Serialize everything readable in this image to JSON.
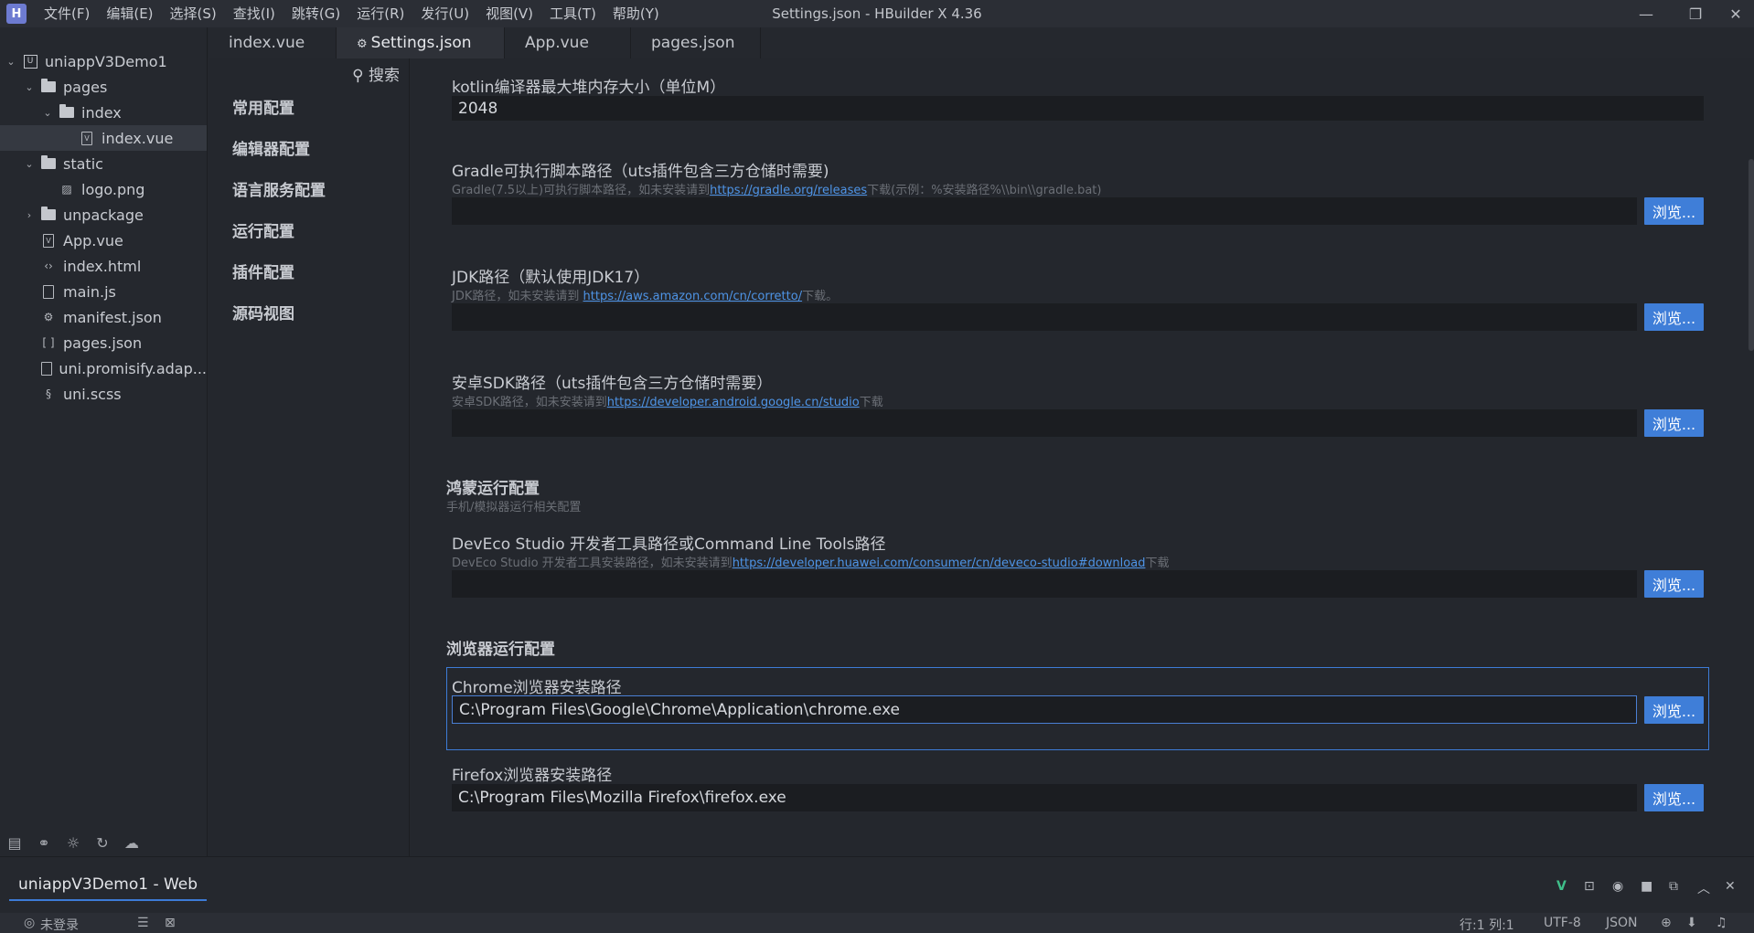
{
  "titlebar": {
    "logo_text": "H",
    "title": "Settings.json - HBuilder X 4.36",
    "menu": [
      "文件(F)",
      "编辑(E)",
      "选择(S)",
      "查找(I)",
      "跳转(G)",
      "运行(R)",
      "发行(U)",
      "视图(V)",
      "工具(T)",
      "帮助(Y)"
    ],
    "minimize": "—",
    "maximize": "❐",
    "close": "✕"
  },
  "tree": {
    "project": "uniappV3Demo1",
    "pages": "pages",
    "index_folder": "index",
    "index_vue": "index.vue",
    "static": "static",
    "logo": "logo.png",
    "unpackage": "unpackage",
    "app_vue": "App.vue",
    "index_html": "index.html",
    "main_js": "main.js",
    "manifest": "manifest.json",
    "pages_json": "pages.json",
    "uni_promisify": "uni.promisify.adap...",
    "uni_scss": "uni.scss"
  },
  "tabs": [
    "index.vue",
    "Settings.json",
    "App.vue",
    "pages.json"
  ],
  "settings_nav": {
    "search": "搜索",
    "items": [
      "常用配置",
      "编辑器配置",
      "语言服务配置",
      "运行配置",
      "插件配置",
      "源码视图"
    ]
  },
  "settings": {
    "browse": "浏览...",
    "kotlin": {
      "label": "kotlin编译器最大堆内存大小（单位M）",
      "value": "2048"
    },
    "gradle": {
      "label": "Gradle可执行脚本路径（uts插件包含三方仓储时需要)",
      "desc_pre": "Gradle(7.5以上)可执行脚本路径，如未安装请到",
      "desc_link": "https://gradle.org/releases",
      "desc_post": "下载(示例：%安装路径%\\\\bin\\\\gradle.bat)",
      "value": ""
    },
    "jdk": {
      "label": "JDK路径（默认使用JDK17）",
      "desc_pre": "JDK路径，如未安装请到 ",
      "desc_link": "https://aws.amazon.com/cn/corretto/",
      "desc_post": "下载。",
      "value": ""
    },
    "android_sdk": {
      "label": "安卓SDK路径（uts插件包含三方仓储时需要）",
      "desc_pre": "安卓SDK路径，如未安装请到",
      "desc_link": "https://developer.android.google.cn/studio",
      "desc_post": "下载",
      "value": ""
    },
    "harmony_section": {
      "title": "鸿蒙运行配置",
      "desc": "手机/模拟器运行相关配置"
    },
    "deveco": {
      "label": "DevEco Studio 开发者工具路径或Command Line Tools路径",
      "desc_pre": "DevEco Studio 开发者工具安装路径，如未安装请到",
      "desc_link": "https://developer.huawei.com/consumer/cn/deveco-studio#download",
      "desc_post": "下载",
      "value": ""
    },
    "browser_section": {
      "title": "浏览器运行配置"
    },
    "chrome": {
      "label": "Chrome浏览器安装路径",
      "value": "C:\\Program Files\\Google\\Chrome\\Application\\chrome.exe"
    },
    "firefox": {
      "label": "Firefox浏览器安装路径",
      "value": "C:\\Program Files\\Mozilla Firefox\\firefox.exe"
    }
  },
  "console": {
    "tab": "uniappV3Demo1 - Web"
  },
  "statusbar": {
    "login": "未登录",
    "position": "行:1  列:1",
    "encoding": "UTF-8",
    "language": "JSON"
  }
}
